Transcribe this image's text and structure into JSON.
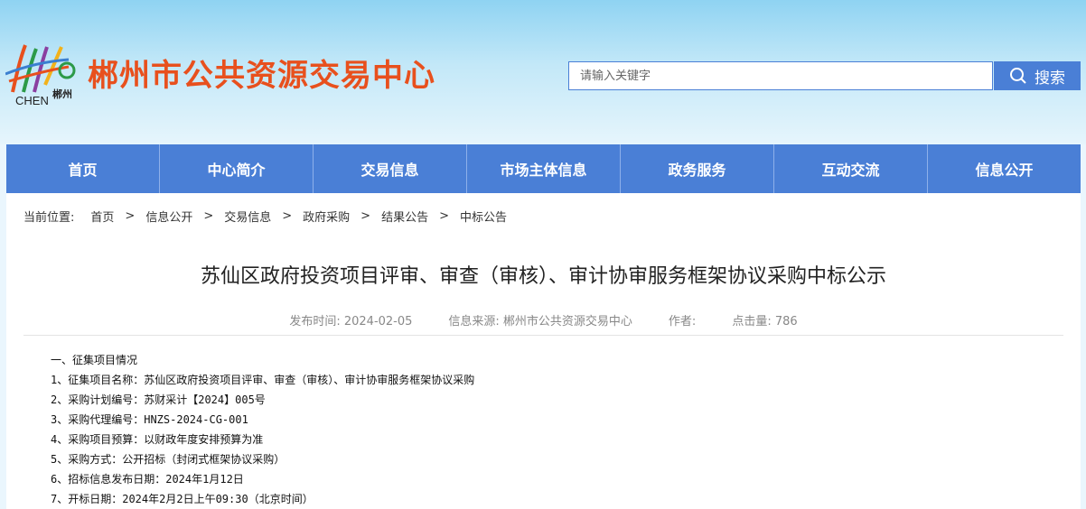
{
  "header": {
    "logo_cn": "郴州",
    "logo_en": "CHEN",
    "site_title": "郴州市公共资源交易中心",
    "search": {
      "placeholder": "请输入关键字",
      "button_label": "搜索"
    }
  },
  "nav": {
    "items": [
      "首页",
      "中心简介",
      "交易信息",
      "市场主体信息",
      "政务服务",
      "互动交流",
      "信息公开"
    ]
  },
  "breadcrumb": {
    "label": "当前位置:",
    "items": [
      "首页",
      "信息公开",
      "交易信息",
      "政府采购",
      "结果公告",
      "中标公告"
    ],
    "separator": ">"
  },
  "article": {
    "title": "苏仙区政府投资项目评审、审查（审核）、审计协审服务框架协议采购中标公示",
    "meta": {
      "publish": "发布时间:  2024-02-05",
      "source": "信息来源:   郴州市公共资源交易中心",
      "author": "作者:",
      "views": "点击量:  786"
    },
    "lines": [
      "一、征集项目情况",
      "1、征集项目名称：苏仙区政府投资项目评审、审查（审核）、审计协审服务框架协议采购",
      "2、采购计划编号：苏财采计【2024】005号",
      "3、采购代理编号：HNZS-2024-CG-001",
      "4、采购项目预算：以财政年度安排预算为准",
      "5、采购方式：公开招标（封闭式框架协议采购）",
      "6、招标信息发布日期：2024年1月12日",
      "7、开标日期：2024年2月2日上午09:30（北京时间）"
    ]
  },
  "colors": {
    "brand_title": "#e8501d",
    "nav_bg": "#4a7fd6",
    "header_gradient_top": "#8fd3f2"
  }
}
